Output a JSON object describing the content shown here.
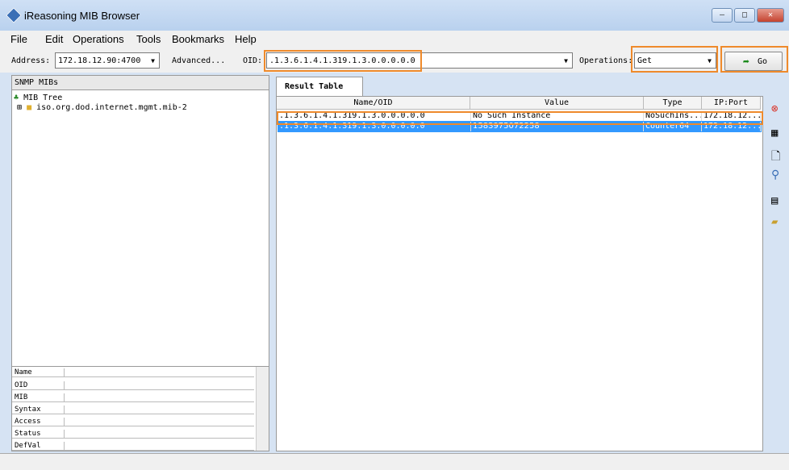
{
  "win": {
    "title": "iReasoning MIB Browser"
  },
  "menu": [
    "File",
    "Edit",
    "Operations",
    "Tools",
    "Bookmarks",
    "Help"
  ],
  "tb": {
    "addr_l": "Address:",
    "addr": "172.18.12.90:4700",
    "adv": "Advanced...",
    "oid_l": "OID:",
    "oid": ".1.3.6.1.4.1.319.1.3.0.0.0.0.0",
    "ops_l": "Operations:",
    "op": "Get",
    "go": "Go"
  },
  "left": {
    "head": "SNMP MIBs",
    "root": "MIB Tree",
    "node": "iso.org.dod.internet.mgmt.mib-2"
  },
  "props": [
    "Name",
    "OID",
    "MIB",
    "Syntax",
    "Access",
    "Status",
    "DefVal"
  ],
  "tab": "Result Table",
  "cols": [
    "Name/OID",
    "Value",
    "Type",
    "IP:Port"
  ],
  "rows": [
    [
      ".1.3.6.1.4.1.319.1.3.0.0.0.0.0",
      "No Such Instance",
      "NoSuchIns...",
      "172.18.12..."
    ],
    [
      ".1.3.6.1.4.1.319.1.3.0.0.0.0.0",
      "1583975072258",
      "Counter64",
      "172.18.12..."
    ]
  ]
}
